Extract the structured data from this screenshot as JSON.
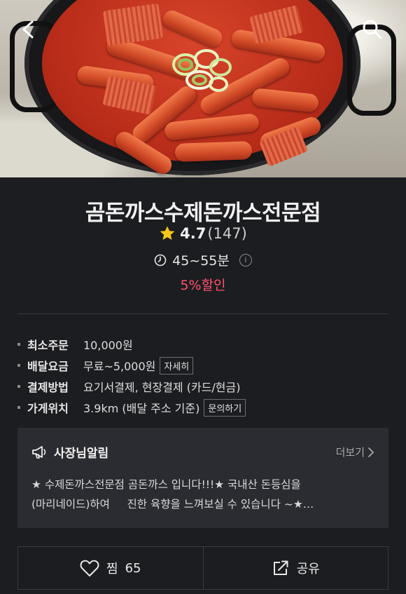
{
  "nav": {
    "back_icon": "back-arrow-icon",
    "search_icon": "search-icon"
  },
  "store": {
    "name": "곰돈까스수제돈까스전문점",
    "rating": "4.7",
    "review_count": "(147)",
    "delivery_time": "45~55분",
    "discount": "5%할인",
    "info_badge": "i"
  },
  "details": [
    {
      "label": "최소주문",
      "value": "10,000원",
      "button": ""
    },
    {
      "label": "배달요금",
      "value": "무료~5,000원",
      "button": "자세히"
    },
    {
      "label": "결제방법",
      "value": "요기서결제, 현장결제 (카드/현금)",
      "button": ""
    },
    {
      "label": "가게위치",
      "value": "3.9km (배달 주소 기준)",
      "button": "문의하기"
    }
  ],
  "notice": {
    "title": "사장님알림",
    "more": "더보기",
    "line1": "★ 수제돈까스전문점 곰돈까스 입니다!!!★ 국내산 돈등심을",
    "line2": "(마리네이드)하여     진한 육향을 느껴보실 수 있습니다 ~★…"
  },
  "actions": {
    "like_label": "찜",
    "like_count": "65",
    "share_label": "공유"
  },
  "colors": {
    "background": "#1c1d21",
    "accent": "#ff4f6c",
    "star": "#f5c518",
    "card": "#2b2c31"
  }
}
